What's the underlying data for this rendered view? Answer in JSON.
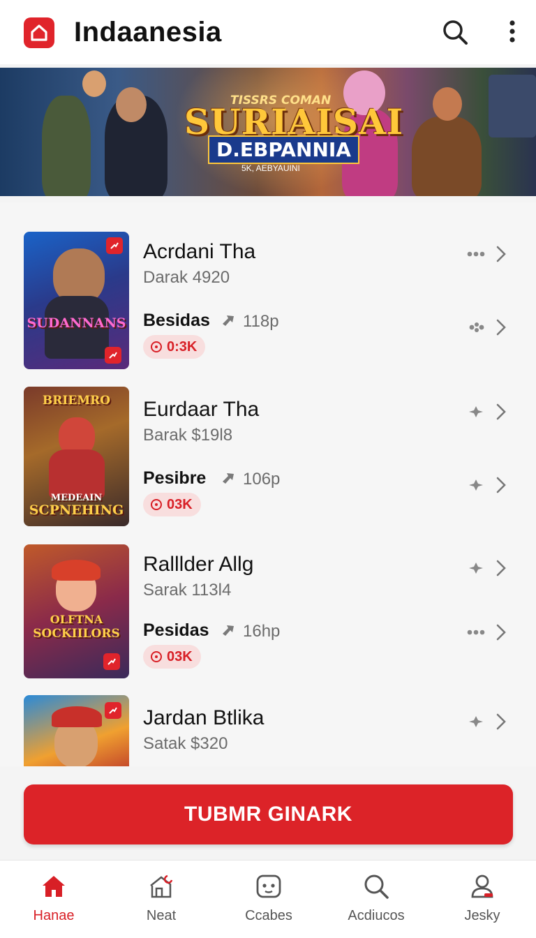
{
  "header": {
    "title": "Indaanesia",
    "logo_icon": "home-logo-icon",
    "search_icon": "search-icon",
    "menu_icon": "more-vertical-icon"
  },
  "banner": {
    "logo_top": "TISSRS COMAN",
    "logo_main": "SURIAISAI",
    "logo_sub": "D.EBPANNIA",
    "logo_tag": "5K, AEBYAUINI"
  },
  "items": [
    {
      "title": "Acrdani Tha",
      "subtitle": "Darak 4920",
      "label": "Besidas",
      "stat": "118p",
      "pill": "0:3K",
      "thumb_title": "SUDANNANS",
      "row1_icon": "more-dots-icon",
      "row2_icon": "flower-icon"
    },
    {
      "title": "Eurdaar Tha",
      "subtitle": "Barak $19l8",
      "label": "Pesibre",
      "stat": "106p",
      "pill": "03K",
      "thumb_title_top": "BRIEMRO",
      "thumb_title": "SCPNEHING",
      "thumb_title_small": "MEDEAIN",
      "row1_icon": "sparkle-icon",
      "row2_icon": "sparkle-icon"
    },
    {
      "title": "Ralllder Allg",
      "subtitle": "Sarak 113l4",
      "label": "Pesidas",
      "stat": "16hp",
      "pill": "03K",
      "thumb_title_top": "OLFTNA",
      "thumb_title": "SOCKIILORS",
      "row1_icon": "sparkle-icon",
      "row2_icon": "more-dots-icon"
    },
    {
      "title": "Jardan Btlika",
      "subtitle": "Satak $320",
      "row1_icon": "sparkle-icon"
    }
  ],
  "cta": {
    "label": "TUBMR GINARK"
  },
  "nav": [
    {
      "label": "Hanae",
      "icon": "home-icon",
      "active": true
    },
    {
      "label": "Neat",
      "icon": "house-repair-icon",
      "active": false
    },
    {
      "label": "Ccabes",
      "icon": "gamepad-icon",
      "active": false
    },
    {
      "label": "Acdiucos",
      "icon": "search-icon",
      "active": false
    },
    {
      "label": "Jesky",
      "icon": "profile-icon",
      "active": false
    }
  ],
  "colors": {
    "accent": "#dc2328",
    "pill_bg": "#f8dede",
    "text_muted": "#6b6b6b"
  }
}
